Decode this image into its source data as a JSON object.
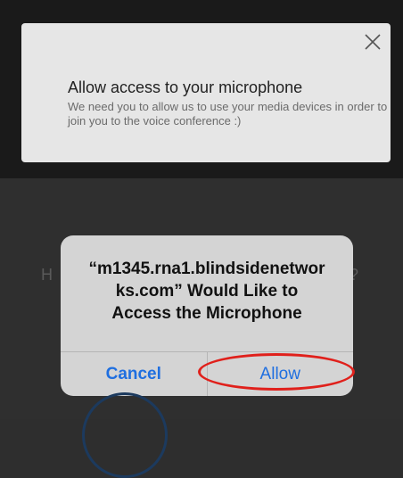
{
  "modal": {
    "title": "Allow access to your microphone",
    "body": "We need you to allow us to use your media devices in order to join you to the voice conference :)",
    "close_icon": "close-icon"
  },
  "alert": {
    "message": "“m1345.rna1.blindsidenetworks.com” Would Like to Access the Microphone",
    "message_line1": "“m1345.rna1.blindsidenetwor",
    "message_line2": "ks.com” Would Like to",
    "message_line3": "Access the Microphone",
    "cancel_label": "Cancel",
    "allow_label": "Allow"
  },
  "colors": {
    "accent": "#1f6fe0",
    "highlight": "#e0201b"
  }
}
